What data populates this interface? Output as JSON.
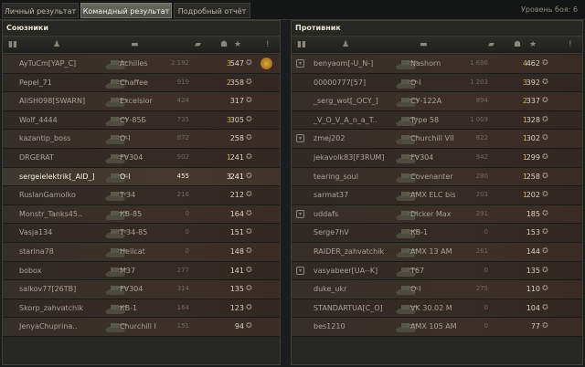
{
  "tabs": [
    "Личный результат",
    "Командный результат",
    "Подробный отчёт"
  ],
  "level_text": "Уровень боя: 6",
  "allies": {
    "title": "Союзники",
    "players": [
      {
        "clan": false,
        "name": "AyTuCm[YAP_C]",
        "tank": "Achilles",
        "damage": "2 192",
        "frags": "3",
        "xp": "547",
        "medal": true
      },
      {
        "clan": false,
        "name": "Pepel_71",
        "tank": "Chaffee",
        "damage": "919",
        "frags": "2",
        "xp": "358",
        "medal": false
      },
      {
        "clan": false,
        "name": "AliSH098[SWARN]",
        "tank": "Excelsior",
        "damage": "424",
        "frags": "",
        "xp": "317",
        "medal": false
      },
      {
        "clan": false,
        "name": "Wolf_4444",
        "tank": "СУ-85Б",
        "damage": "735",
        "frags": "3",
        "xp": "305",
        "medal": false
      },
      {
        "clan": false,
        "name": "kazantip_boss",
        "tank": "О-I",
        "damage": "872",
        "frags": "",
        "xp": "258",
        "medal": false
      },
      {
        "clan": false,
        "name": "DRGERAT",
        "tank": "FV304",
        "damage": "902",
        "frags": "1",
        "xp": "241",
        "medal": false
      },
      {
        "clan": false,
        "name": "sergeielektrik[_AID_]",
        "tank": "О-I",
        "damage": "455",
        "frags": "3",
        "xp": "241",
        "medal": false,
        "me": true
      },
      {
        "clan": false,
        "name": "RuslanGamolko",
        "tank": "T-34",
        "damage": "216",
        "frags": "",
        "xp": "212",
        "medal": false
      },
      {
        "clan": false,
        "name": "Monstr_Tanks45..",
        "tank": "КВ-85",
        "damage": "0",
        "frags": "",
        "xp": "164",
        "medal": false
      },
      {
        "clan": false,
        "name": "Vasja134",
        "tank": "T-34-85",
        "damage": "0",
        "frags": "",
        "xp": "151",
        "medal": false
      },
      {
        "clan": false,
        "name": "starina78",
        "tank": "Hellcat",
        "damage": "0",
        "frags": "",
        "xp": "148",
        "medal": false
      },
      {
        "clan": false,
        "name": "bobox",
        "tank": "M37",
        "damage": "277",
        "frags": "",
        "xp": "141",
        "medal": false
      },
      {
        "clan": false,
        "name": "salkov77[26TB]",
        "tank": "FV304",
        "damage": "314",
        "frags": "",
        "xp": "135",
        "medal": false
      },
      {
        "clan": false,
        "name": "Skorp_zahvatchik",
        "tank": "КВ-1",
        "damage": "164",
        "frags": "",
        "xp": "123",
        "medal": false
      },
      {
        "clan": false,
        "name": "JenyaChuprina..",
        "tank": "Churchill I",
        "damage": "151",
        "frags": "",
        "xp": "94",
        "medal": false
      }
    ]
  },
  "enemies": {
    "title": "Противник",
    "players": [
      {
        "clan": true,
        "name": "benyaom[-U_N-]",
        "tank": "Nashorn",
        "damage": "1 696",
        "frags": "4",
        "xp": "462"
      },
      {
        "clan": false,
        "name": "00000777[57]",
        "tank": "О-I",
        "damage": "1 203",
        "frags": "3",
        "xp": "392"
      },
      {
        "clan": false,
        "name": "_serg_wot[_OCY_]",
        "tank": "СУ-122А",
        "damage": "894",
        "frags": "2",
        "xp": "337"
      },
      {
        "clan": false,
        "name": "_V_O_V_A_n_a_T..",
        "tank": "Type 58",
        "damage": "1 009",
        "frags": "1",
        "xp": "328"
      },
      {
        "clan": true,
        "name": "zmej202",
        "tank": "Churchill VII",
        "damage": "822",
        "frags": "1",
        "xp": "302"
      },
      {
        "clan": false,
        "name": "jekavolk83[F3RUM]",
        "tank": "FV304",
        "damage": "942",
        "frags": "1",
        "xp": "299"
      },
      {
        "clan": false,
        "name": "tearing_soul",
        "tank": "Covenanter",
        "damage": "280",
        "frags": "1",
        "xp": "258"
      },
      {
        "clan": false,
        "name": "sarmat37",
        "tank": "AMX ELC bis",
        "damage": "203",
        "frags": "1",
        "xp": "202"
      },
      {
        "clan": true,
        "name": "uddafs",
        "tank": "Dicker Max",
        "damage": "291",
        "frags": "",
        "xp": "185"
      },
      {
        "clan": false,
        "name": "Serge7hV",
        "tank": "КВ-1",
        "damage": "0",
        "frags": "",
        "xp": "153"
      },
      {
        "clan": false,
        "name": "RAIDER_zahvatchik",
        "tank": "AMX 13 AM",
        "damage": "281",
        "frags": "",
        "xp": "144"
      },
      {
        "clan": true,
        "name": "vasyabeer[UA--K]",
        "tank": "T67",
        "damage": "0",
        "frags": "",
        "xp": "135"
      },
      {
        "clan": false,
        "name": "duke_ukr",
        "tank": "О-I",
        "damage": "275",
        "frags": "",
        "xp": "110"
      },
      {
        "clan": false,
        "name": "STANDARTUA[C_O]",
        "tank": "VK 30.02 M",
        "damage": "0",
        "frags": "",
        "xp": "104"
      },
      {
        "clan": false,
        "name": "bes1210",
        "tank": "AMX 105 AM",
        "damage": "0",
        "frags": "",
        "xp": "77"
      }
    ]
  },
  "colors": {
    "accent_frags": "#c9b25a",
    "row_tint": "#3d3028"
  }
}
